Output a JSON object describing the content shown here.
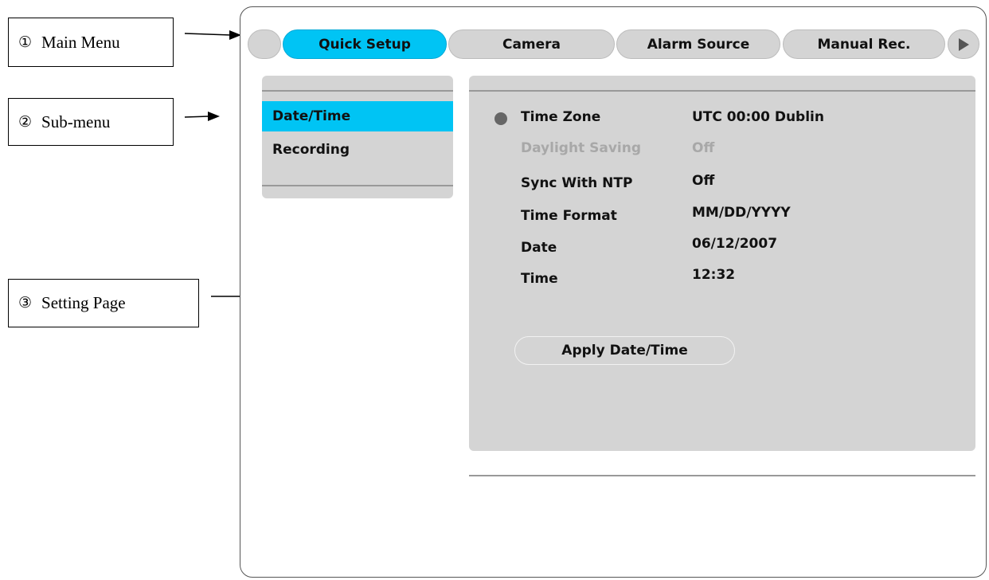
{
  "callouts": [
    {
      "number": "①",
      "label": "Main Menu"
    },
    {
      "number": "②",
      "label": "Sub-menu"
    },
    {
      "number": "③",
      "label": "Setting Page"
    }
  ],
  "main_menu": {
    "tabs": [
      "Quick Setup",
      "Camera",
      "Alarm Source",
      "Manual Rec."
    ],
    "active_tab": "Quick Setup",
    "next_icon": "play-triangle-icon"
  },
  "sub_menu": {
    "items": [
      "Date/Time",
      "Recording"
    ],
    "active_item": "Date/Time"
  },
  "settings": {
    "rows": [
      {
        "label": "Time Zone",
        "value": "UTC 00:00 Dublin",
        "enabled": true,
        "selected": true
      },
      {
        "label": "Daylight Saving",
        "value": "Off",
        "enabled": false,
        "selected": false
      },
      {
        "label": "Sync With NTP",
        "value": "Off",
        "enabled": true,
        "selected": false
      },
      {
        "label": "Time Format",
        "value": "MM/DD/YYYY",
        "enabled": true,
        "selected": false
      },
      {
        "label": "Date",
        "value": "06/12/2007",
        "enabled": true,
        "selected": false
      },
      {
        "label": "Time",
        "value": "12:32",
        "enabled": true,
        "selected": false
      }
    ],
    "apply_button": "Apply Date/Time"
  },
  "colors": {
    "accent": "#00c4f4",
    "panel": "#d4d4d4",
    "disabled_text": "#a8a8a8"
  }
}
